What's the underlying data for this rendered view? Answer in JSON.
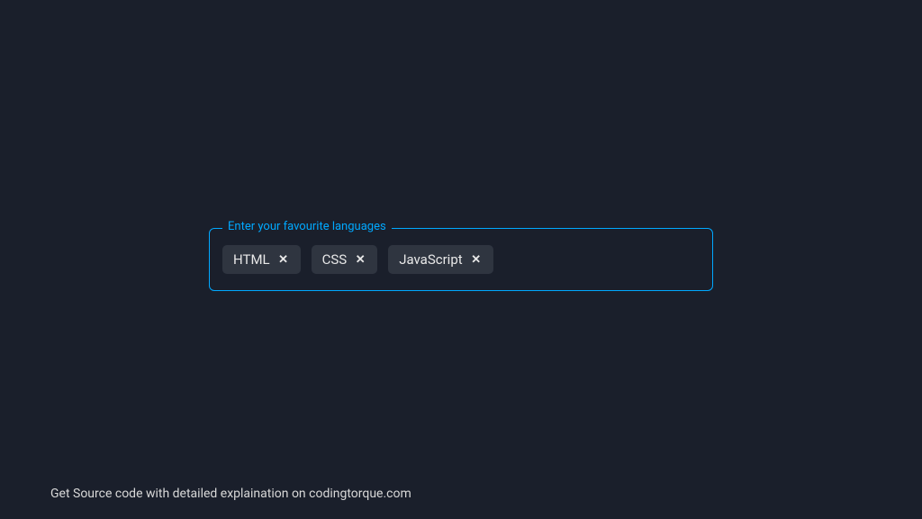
{
  "tagInput": {
    "label": "Enter your favourite languages",
    "tags": [
      {
        "label": "HTML"
      },
      {
        "label": "CSS"
      },
      {
        "label": "JavaScript"
      }
    ],
    "inputValue": "",
    "inputPlaceholder": ""
  },
  "footer": {
    "text": "Get Source code with detailed explaination on codingtorque.com"
  },
  "colors": {
    "background": "#1a1f2b",
    "accent": "#00a8ff",
    "tagBackground": "#2f3540",
    "textLight": "#e8e8e8"
  }
}
